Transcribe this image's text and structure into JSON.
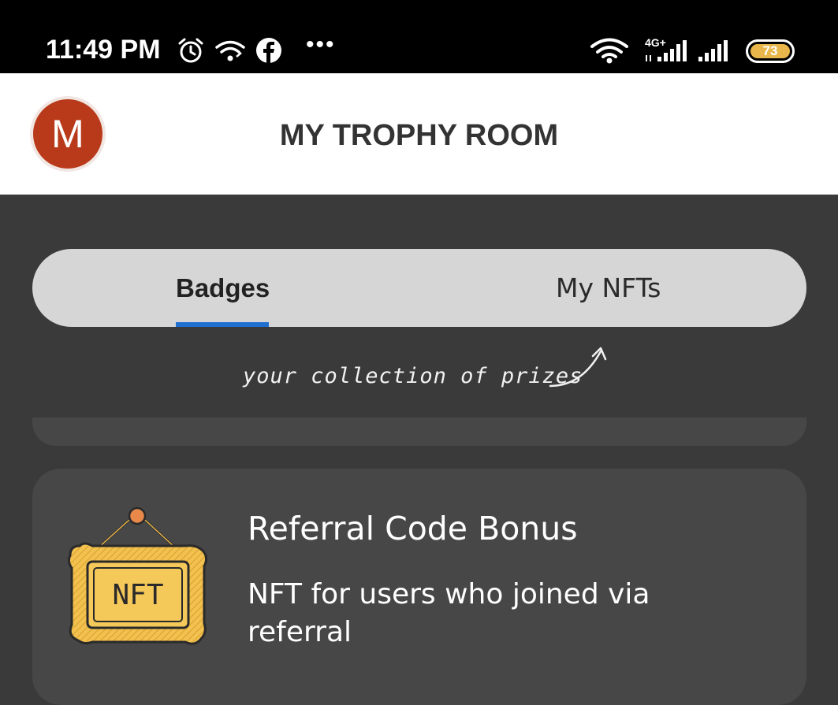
{
  "status_bar": {
    "time": "11:49 PM",
    "network_label": "4G+",
    "battery_level": "73",
    "icons": [
      "alarm-icon",
      "wifi-link-icon",
      "facebook-icon",
      "more-dots-icon",
      "wifi-icon",
      "signal-4g-icon",
      "signal-icon",
      "battery-icon"
    ],
    "more": "•••"
  },
  "header": {
    "avatar_initial": "M",
    "title": "MY TROPHY ROOM"
  },
  "tabs": [
    {
      "label": "Badges",
      "active": true
    },
    {
      "label": "My NFTs",
      "active": false
    }
  ],
  "hint": "your collection of prizes",
  "badge": {
    "image_text": "NFT",
    "title": "Referral Code Bonus",
    "description": "NFT for users who joined via referral"
  },
  "colors": {
    "accent": "#1f6fd1",
    "avatar": "#b93a1b",
    "background": "#3a3a3a",
    "card": "#474747",
    "battery": "#e8b64a"
  }
}
